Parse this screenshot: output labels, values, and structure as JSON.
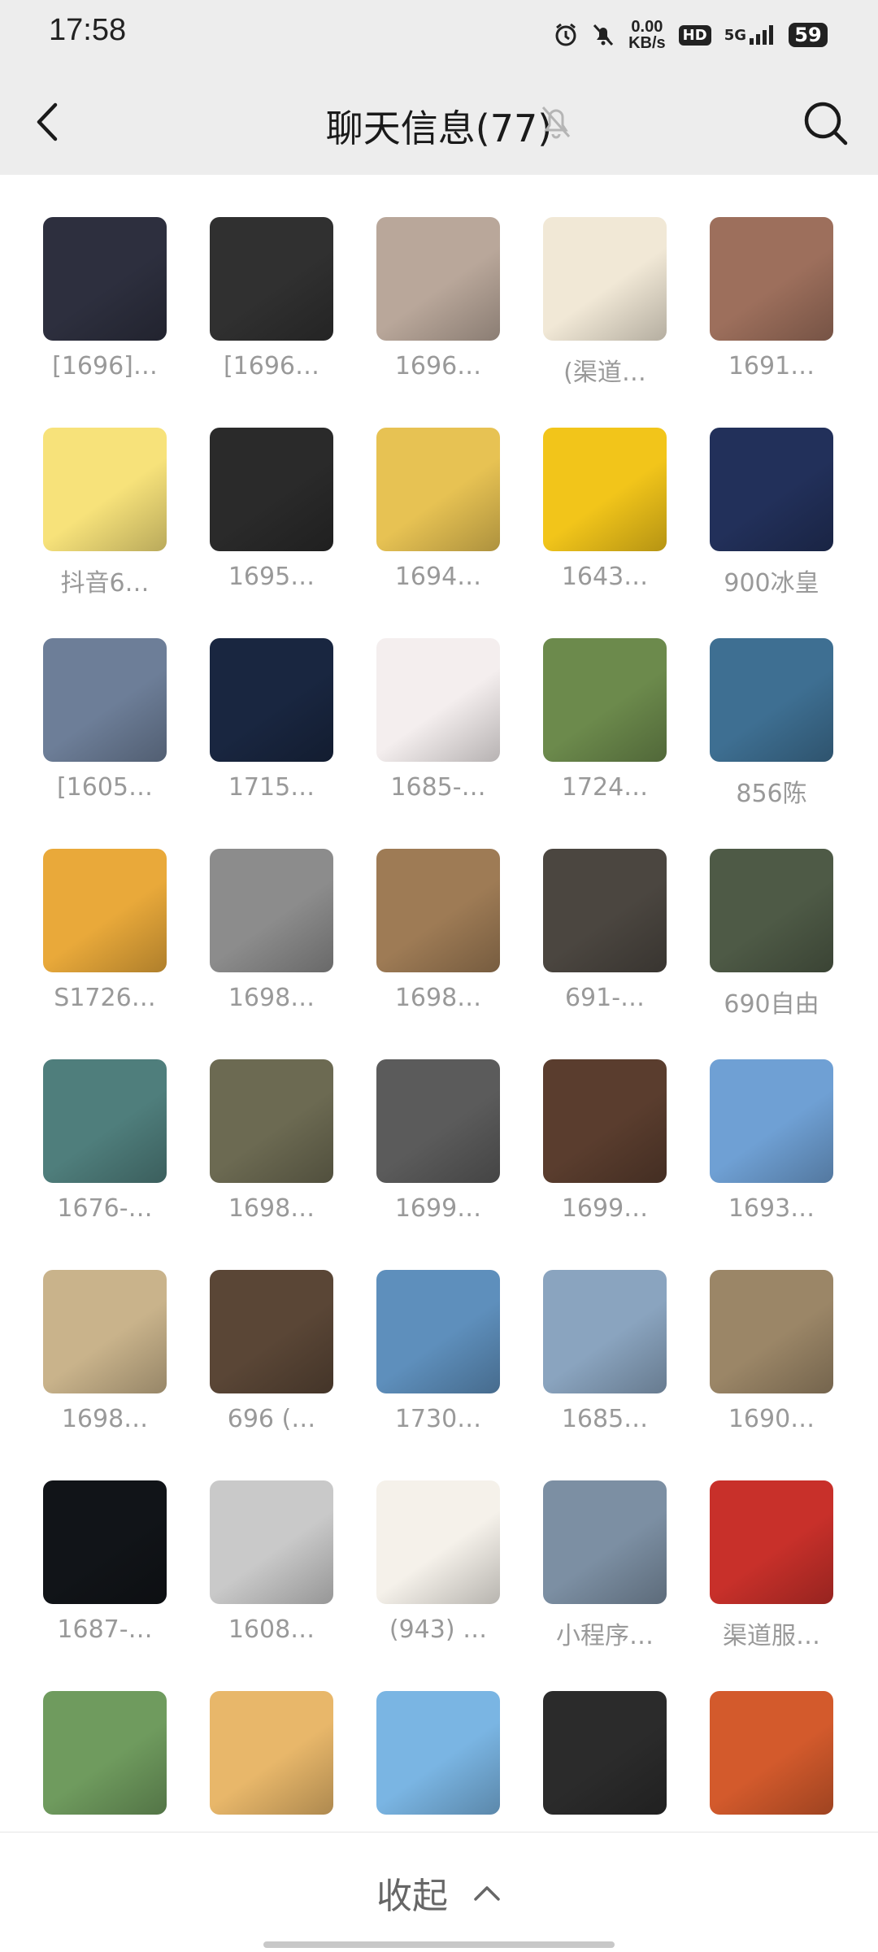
{
  "status_bar": {
    "time": "17:58",
    "net_speed_value": "0.00",
    "net_speed_unit": "KB/s",
    "hd": "HD",
    "network": "5G",
    "battery": "59"
  },
  "header": {
    "title": "聊天信息(77)"
  },
  "members": [
    {
      "name": "[1696]…",
      "color": "#2d2f3e"
    },
    {
      "name": "[1696…",
      "color": "#303030"
    },
    {
      "name": "1696…",
      "color": "#b9a79a"
    },
    {
      "name": "(渠道…",
      "color": "#f1e8d6"
    },
    {
      "name": "1691…",
      "color": "#9d6f5c"
    },
    {
      "name": "抖音6…",
      "color": "#f7e27a"
    },
    {
      "name": "1695…",
      "color": "#2a2a2a"
    },
    {
      "name": "1694…",
      "color": "#e7c253"
    },
    {
      "name": "1643…",
      "color": "#f2c51a"
    },
    {
      "name": "900冰皇",
      "color": "#22305a"
    },
    {
      "name": "[1605…",
      "color": "#6d7e98"
    },
    {
      "name": "1715…",
      "color": "#192640"
    },
    {
      "name": "1685-…",
      "color": "#f4eeee"
    },
    {
      "name": "1724…",
      "color": "#6c8a4c"
    },
    {
      "name": "856陈",
      "color": "#3e6f92"
    },
    {
      "name": "S1726…",
      "color": "#e9a93a"
    },
    {
      "name": "1698…",
      "color": "#8c8c8c"
    },
    {
      "name": "1698…",
      "color": "#9e7b55"
    },
    {
      "name": "691-…",
      "color": "#4b4640"
    },
    {
      "name": "690自由",
      "color": "#4e5a46"
    },
    {
      "name": "1676-…",
      "color": "#4f7e7c"
    },
    {
      "name": "1698…",
      "color": "#6c6a52"
    },
    {
      "name": "1699…",
      "color": "#5b5b5b"
    },
    {
      "name": "1699…",
      "color": "#5a3d2e"
    },
    {
      "name": "1693…",
      "color": "#6fa0d4"
    },
    {
      "name": "1698…",
      "color": "#c9b38b"
    },
    {
      "name": "696 (…",
      "color": "#5a4636"
    },
    {
      "name": "1730…",
      "color": "#5e8fbc"
    },
    {
      "name": "1685…",
      "color": "#8aa4bf"
    },
    {
      "name": "1690…",
      "color": "#9b8667"
    },
    {
      "name": "1687-…",
      "color": "#111418"
    },
    {
      "name": "1608…",
      "color": "#c9c9c9"
    },
    {
      "name": "(943) …",
      "color": "#f5f1ea"
    },
    {
      "name": "小程序…",
      "color": "#7c8fa3"
    },
    {
      "name": "渠道服…",
      "color": "#c8302a"
    },
    {
      "name": "",
      "color": "#6f9b5e"
    },
    {
      "name": "",
      "color": "#e8b76a"
    },
    {
      "name": "",
      "color": "#7ab5e3"
    },
    {
      "name": "",
      "color": "#2b2b2b"
    },
    {
      "name": "",
      "color": "#d35a2c"
    }
  ],
  "footer": {
    "collapse_label": "收起"
  }
}
